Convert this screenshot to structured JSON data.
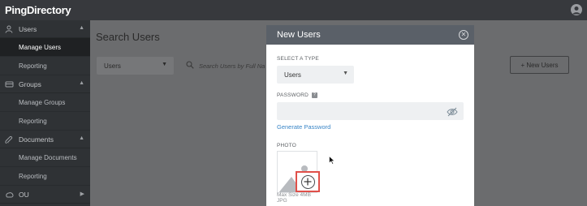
{
  "app": {
    "logo": "PingDirectory"
  },
  "sidebar": {
    "sections": [
      {
        "label": "Users",
        "icon": "user-icon",
        "items": [
          "Manage Users",
          "Reporting"
        ]
      },
      {
        "label": "Groups",
        "icon": "groups-icon",
        "items": [
          "Manage Groups",
          "Reporting"
        ]
      },
      {
        "label": "Documents",
        "icon": "documents-icon",
        "items": [
          "Manage Documents",
          "Reporting"
        ]
      },
      {
        "label": "OU",
        "icon": "ou-icon",
        "items": []
      }
    ],
    "active_item": "Manage Users"
  },
  "main": {
    "title": "Search Users",
    "type_select": "Users",
    "search_placeholder": "Search Users by Full Na",
    "new_users_button": "+ New Users"
  },
  "modal": {
    "title": "New Users",
    "select_type_label": "SELECT A TYPE",
    "select_type_value": "Users",
    "password_label": "PASSWORD",
    "generate_password": "Generate Password",
    "photo_label": "PHOTO",
    "max_size": "Max Size 4MB",
    "formats": "JPG"
  },
  "colors": {
    "accent_link": "#3a86c7",
    "highlight": "#e0504a",
    "modal_header": "#5a6068"
  }
}
